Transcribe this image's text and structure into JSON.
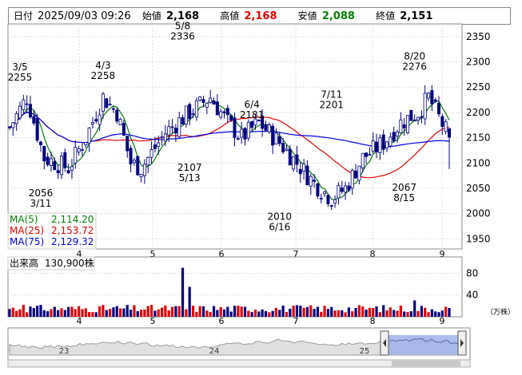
{
  "header": {
    "date_label": "日付",
    "datetime": "2025/09/03 09:26",
    "open_label": "始値",
    "open": "2,168",
    "high_label": "高値",
    "high": "2,168",
    "low_label": "安値",
    "low": "2,088",
    "close_label": "終値",
    "close": "2,151"
  },
  "colors": {
    "ma5": "#008000",
    "ma25": "#e60000",
    "ma75": "#0000e6",
    "up_candle": "#ffffff",
    "down_candle": "#000080",
    "volume_up": "#e60000",
    "volume_down": "#000080",
    "navigator_fill": "#9db0e8"
  },
  "legend": {
    "ma5_label": "MA(5)",
    "ma5_value": "2,114.20",
    "ma25_label": "MA(25)",
    "ma25_value": "2,153.72",
    "ma75_label": "MA(75)",
    "ma75_value": "2,129.32"
  },
  "volume_legend": {
    "label": "出来高",
    "value": "130,900株"
  },
  "volume_unit": "（万株）",
  "chart_data": [
    {
      "type": "candlestick",
      "x_ticks": [
        "4",
        "5",
        "6",
        "7",
        "8",
        "9"
      ],
      "y_ticks": [
        1950,
        2000,
        2050,
        2100,
        2150,
        2200,
        2250,
        2300,
        2350
      ],
      "ylim": [
        1930,
        2375
      ],
      "grid": true,
      "annotations": [
        {
          "date": "3/5",
          "value": "2255"
        },
        {
          "date": "3/11",
          "value": "2056"
        },
        {
          "date": "4/3",
          "value": "2258"
        },
        {
          "date": "5/8",
          "value": "2336"
        },
        {
          "date": "5/13",
          "value": "2107"
        },
        {
          "date": "6/4",
          "value": "2181"
        },
        {
          "date": "6/16",
          "value": "2010"
        },
        {
          "date": "7/11",
          "value": "2201"
        },
        {
          "date": "8/15",
          "value": "2067"
        },
        {
          "date": "8/20",
          "value": "2276"
        }
      ],
      "series": [
        {
          "name": "MA(5)",
          "last": 2114.2
        },
        {
          "name": "MA(25)",
          "last": 2153.72
        },
        {
          "name": "MA(75)",
          "last": 2129.32
        }
      ],
      "last_candle": {
        "open": 2168,
        "high": 2168,
        "low": 2088,
        "close": 2151
      }
    },
    {
      "type": "bar",
      "title": "出来高",
      "y_ticks": [
        40,
        80
      ],
      "x_ticks": [
        "4",
        "5",
        "6",
        "7",
        "8",
        "9"
      ],
      "grid": true
    },
    {
      "type": "area",
      "x_ticks": [
        "23",
        "24",
        "25"
      ]
    }
  ]
}
